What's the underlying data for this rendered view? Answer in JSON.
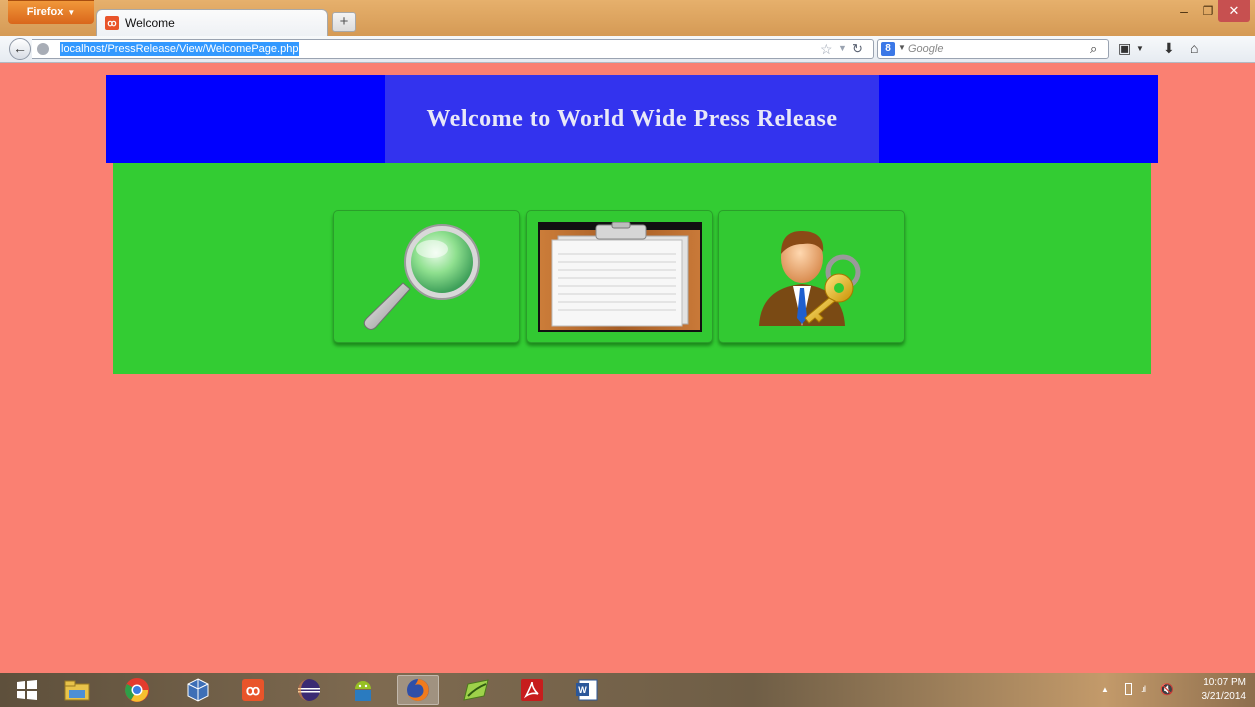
{
  "browser": {
    "menu_label": "Firefox",
    "tab": {
      "title": "Welcome",
      "favicon": "xampp-icon"
    },
    "new_tab_label": "+",
    "url": "localhost/PressRelease/View/WelcomePage.php",
    "search_placeholder": "Google",
    "window_controls": {
      "minimize": "–",
      "maximize": "❐",
      "close": "✕"
    }
  },
  "page": {
    "title": "Welcome to World Wide Press Release",
    "background": "#fa8072",
    "header_color": "#0000ff",
    "content_color": "#33cc33",
    "tiles": [
      {
        "id": "search",
        "icon": "magnifier-icon"
      },
      {
        "id": "documents",
        "icon": "clipboard-icon"
      },
      {
        "id": "admin",
        "icon": "user-key-icon"
      }
    ]
  },
  "taskbar": {
    "apps": [
      "start-icon",
      "file-explorer-icon",
      "chrome-icon",
      "virtualbox-icon",
      "xampp-icon",
      "eclipse-icon",
      "android-sdk-icon",
      "firefox-icon",
      "notepad-plus-icon",
      "acrobat-icon",
      "word-icon"
    ],
    "active_app": "firefox-icon",
    "clock": {
      "time": "10:07 PM",
      "date": "3/21/2014"
    }
  }
}
